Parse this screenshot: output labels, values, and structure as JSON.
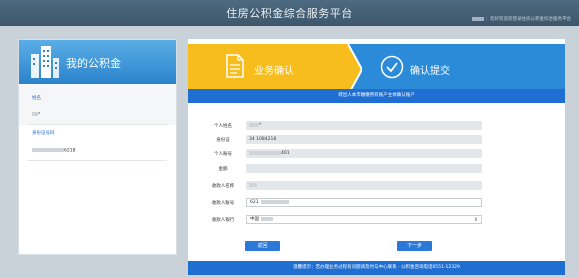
{
  "header": {
    "site_title": "住房公积金综合服务平台",
    "welcome_text": "：您好欢迎您登录住房公积金综合服务平台"
  },
  "sidebar": {
    "title": "我的公积金",
    "name_label": "姓名",
    "name_value": "*",
    "id_label": "身份证号码",
    "id_value": "6218"
  },
  "steps": {
    "step1_label": "业务确认",
    "step2_label": "确认提交"
  },
  "notice_top": "转出人本市缴缴所有账户主体确认账户",
  "form": {
    "fields": [
      {
        "label": "个人姓名",
        "value": "*",
        "type": "readonly"
      },
      {
        "label": "身份证",
        "value": "34 1084218",
        "type": "readonly"
      },
      {
        "label": "个人账号",
        "value": "401",
        "type": "readonly"
      },
      {
        "label": "金额",
        "value": "",
        "type": "readonly"
      },
      {
        "label": "收款人名称",
        "value": "",
        "type": "readonly"
      },
      {
        "label": "收款人账号",
        "value": "621",
        "type": "input"
      },
      {
        "label": "收款人银行",
        "value": "中国",
        "type": "select"
      }
    ]
  },
  "buttons": {
    "back": "返回",
    "next": "下一步"
  },
  "notice_bottom": "温馨提示：若办理业务过程有问题请及时与中心联系 · 公积金咨询电话0551-12329",
  "colors": {
    "header": "#4d6a80",
    "accent_blue": "#1f6fd3",
    "step1_yellow": "#f6bd1c",
    "step2_blue": "#2c8bd8"
  }
}
